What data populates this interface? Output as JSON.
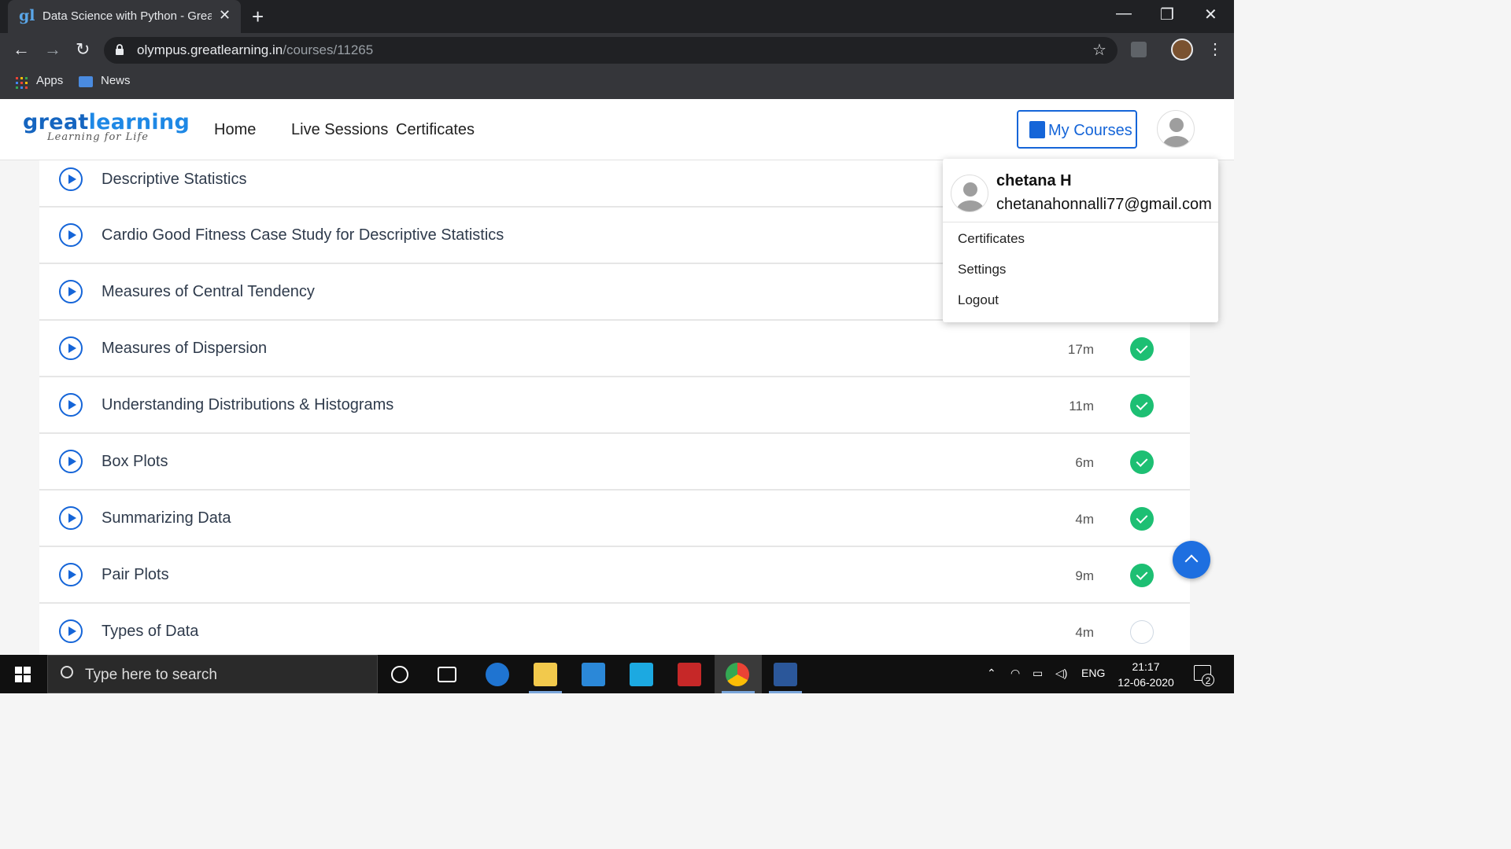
{
  "browser": {
    "tab_title": "Data Science with Python - Great",
    "tab_close": "✕",
    "new_tab": "+",
    "url_host": "olympus.greatlearning.in",
    "url_path": "/courses/11265",
    "bookmarks": [
      {
        "label": "Apps"
      },
      {
        "label": "News"
      }
    ],
    "window_controls": [
      "—",
      "❐",
      "✕"
    ]
  },
  "site": {
    "logo_main_bold": "great",
    "logo_main_light": "learning",
    "logo_tagline": "Learning for Life",
    "nav": [
      "Home",
      "Live Sessions",
      "Certificates"
    ],
    "my_courses": "My Courses"
  },
  "lessons": [
    {
      "title": "Descriptive Statistics",
      "duration": "",
      "completed": null
    },
    {
      "title": "Cardio Good Fitness Case Study for Descriptive Statistics",
      "duration": "",
      "completed": null
    },
    {
      "title": "Measures of Central Tendency",
      "duration": "",
      "completed": null
    },
    {
      "title": "Measures of Dispersion",
      "duration": "17m",
      "completed": true
    },
    {
      "title": "Understanding Distributions & Histograms",
      "duration": "11m",
      "completed": true
    },
    {
      "title": "Box Plots",
      "duration": "6m",
      "completed": true
    },
    {
      "title": "Summarizing Data",
      "duration": "4m",
      "completed": true
    },
    {
      "title": "Pair Plots",
      "duration": "9m",
      "completed": true
    },
    {
      "title": "Types of Data",
      "duration": "4m",
      "completed": false
    }
  ],
  "user_menu": {
    "name": "chetana H",
    "email": "chetanahonnalli77@gmail.com",
    "items": [
      "Certificates",
      "Settings",
      "Logout"
    ]
  },
  "taskbar": {
    "search_placeholder": "Type here to search",
    "language": "ENG",
    "time": "21:17",
    "date": "12-06-2020",
    "notification_count": "2"
  },
  "colors": {
    "accent": "#1565d8",
    "complete": "#1dbf73"
  }
}
